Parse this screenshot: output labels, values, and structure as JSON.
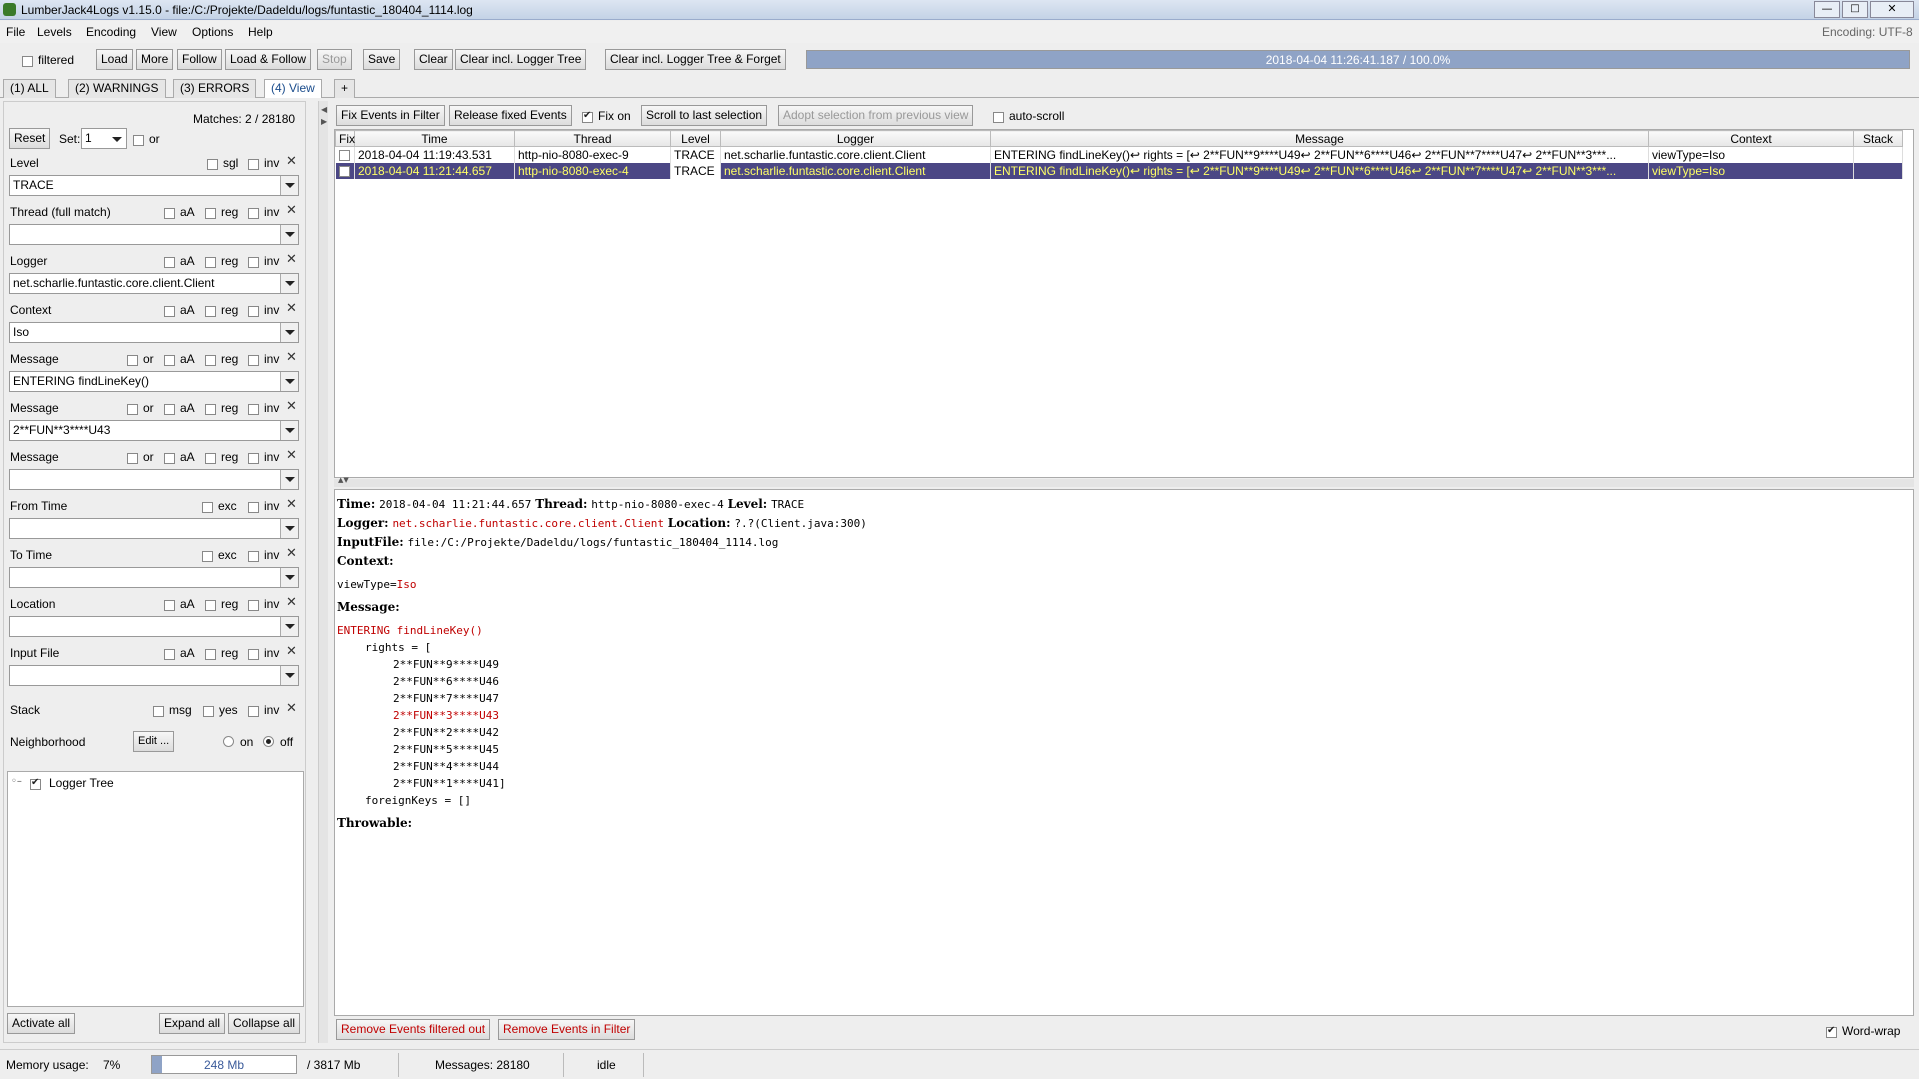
{
  "window": {
    "title": "LumberJack4Logs v1.15.0 - file:/C:/Projekte/Dadeldu/logs/funtastic_180404_1114.log",
    "encoding_label": "Encoding: UTF-8"
  },
  "menu": [
    "File",
    "Levels",
    "Encoding",
    "View",
    "Options",
    "Help"
  ],
  "toolbar": {
    "filtered_label": "filtered",
    "load": "Load",
    "more": "More",
    "follow": "Follow",
    "load_follow": "Load & Follow",
    "stop": "Stop",
    "save": "Save",
    "clear": "Clear",
    "clear_tree": "Clear incl. Logger Tree",
    "clear_forget": "Clear incl. Logger Tree & Forget",
    "progress_text": "2018-04-04 11:26:41.187 / 100.0%",
    "progress_fraction": 1.0
  },
  "tabs": [
    "(1) ALL",
    "(2) WARNINGS",
    "(3) ERRORS",
    "(4) View",
    "+"
  ],
  "filter": {
    "matches": "Matches: 2 / 28180",
    "reset": "Reset",
    "set_label": "Set:",
    "set_value": "1",
    "or_label": "or",
    "level": {
      "label": "Level",
      "sgl": "sgl",
      "inv": "inv",
      "value": "TRACE"
    },
    "thread": {
      "label": "Thread (full match)",
      "aA": "aA",
      "reg": "reg",
      "inv": "inv",
      "value": ""
    },
    "logger": {
      "label": "Logger",
      "aA": "aA",
      "reg": "reg",
      "inv": "inv",
      "value": "net.scharlie.funtastic.core.client.Client"
    },
    "context": {
      "label": "Context",
      "aA": "aA",
      "reg": "reg",
      "inv": "inv",
      "value": "Iso"
    },
    "message1": {
      "label": "Message",
      "or": "or",
      "aA": "aA",
      "reg": "reg",
      "inv": "inv",
      "value": "ENTERING findLineKey()"
    },
    "message2": {
      "label": "Message",
      "or": "or",
      "aA": "aA",
      "reg": "reg",
      "inv": "inv",
      "value": "2**FUN**3****U43"
    },
    "message3": {
      "label": "Message",
      "or": "or",
      "aA": "aA",
      "reg": "reg",
      "inv": "inv",
      "value": ""
    },
    "from_time": {
      "label": "From Time",
      "exc": "exc",
      "inv": "inv",
      "value": ""
    },
    "to_time": {
      "label": "To Time",
      "exc": "exc",
      "inv": "inv",
      "value": ""
    },
    "location": {
      "label": "Location",
      "aA": "aA",
      "reg": "reg",
      "inv": "inv",
      "value": ""
    },
    "input_file": {
      "label": "Input File",
      "aA": "aA",
      "reg": "reg",
      "inv": "inv",
      "value": ""
    },
    "stack": {
      "label": "Stack",
      "msg": "msg",
      "yes": "yes",
      "inv": "inv"
    },
    "neighborhood": {
      "label": "Neighborhood",
      "edit": "Edit ...",
      "on": "on",
      "off": "off"
    },
    "logger_tree": "Logger Tree",
    "activate_all": "Activate all",
    "expand_all": "Expand all",
    "collapse_all": "Collapse all"
  },
  "events_toolbar": {
    "fix_in_filter": "Fix Events in Filter",
    "release": "Release fixed Events",
    "fix_on": "Fix on",
    "scroll_last": "Scroll to last selection",
    "adopt": "Adopt selection from previous view",
    "auto_scroll": "auto-scroll"
  },
  "table": {
    "columns": [
      "Fix",
      "Time",
      "Thread",
      "Level",
      "Logger",
      "Message",
      "Context",
      "Stack"
    ],
    "rows": [
      {
        "time": "2018-04-04 11:19:43.531",
        "thread": "http-nio-8080-exec-9",
        "level": "TRACE",
        "logger": "net.scharlie.funtastic.core.client.Client",
        "message": "ENTERING findLineKey()↩ rights = [↩ 2**FUN**9****U49↩ 2**FUN**6****U46↩ 2**FUN**7****U47↩ 2**FUN**3***...",
        "context": "viewType=Iso",
        "stack": "",
        "selected": false
      },
      {
        "time": "2018-04-04 11:21:44.657",
        "thread": "http-nio-8080-exec-4",
        "level": "TRACE",
        "logger": "net.scharlie.funtastic.core.client.Client",
        "message": "ENTERING findLineKey()↩ rights = [↩ 2**FUN**9****U49↩ 2**FUN**6****U46↩ 2**FUN**7****U47↩ 2**FUN**3***...",
        "context": "viewType=Iso",
        "stack": "",
        "selected": true
      }
    ]
  },
  "detail": {
    "time_label": "Time:",
    "time": "2018-04-04 11:21:44.657",
    "thread_label": "Thread:",
    "thread": "http-nio-8080-exec-4",
    "level_label": "Level:",
    "level": "TRACE",
    "logger_label": "Logger:",
    "logger": "net.scharlie.funtastic.core.client.Client",
    "location_label": "Location:",
    "location": "?.?(Client.java:300)",
    "inputfile_label": "InputFile:",
    "inputfile": "file:/C:/Projekte/Dadeldu/logs/funtastic_180404_1114.log",
    "context_label": "Context:",
    "context_key": "viewType=",
    "context_value": "Iso",
    "message_label": "Message:",
    "message_head": "ENTERING findLineKey()",
    "message_lines": [
      "rights = [",
      "2**FUN**9****U49",
      "2**FUN**6****U46",
      "2**FUN**7****U47",
      "2**FUN**3****U43",
      "2**FUN**2****U42",
      "2**FUN**5****U45",
      "2**FUN**4****U44",
      "2**FUN**1****U41]",
      "foreignKeys = []"
    ],
    "highlight_line": 4,
    "throwable_label": "Throwable:"
  },
  "bottom": {
    "remove_filtered_out": "Remove Events filtered out",
    "remove_in_filter": "Remove Events in Filter",
    "word_wrap": "Word-wrap"
  },
  "status": {
    "memory_label": "Memory usage:",
    "memory_pct": "7%",
    "memory_used": "248 Mb",
    "memory_fraction": 0.07,
    "memory_total": "/ 3817 Mb",
    "messages": "Messages: 28180",
    "state": "idle"
  },
  "colors": {
    "accent": "#c00000",
    "selected_row_bg": "#4b4785",
    "selected_row_fg": "#ffff66",
    "progress": "#8fa3c6"
  }
}
